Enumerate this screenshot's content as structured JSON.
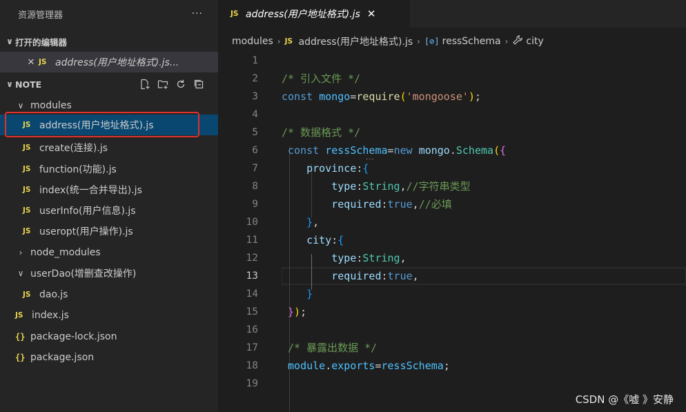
{
  "sidebar": {
    "title": "资源管理器",
    "more": "···",
    "open_editors_section": "打开的编辑器",
    "open_editor_file": "address(用户地址格式).js...",
    "root_section": "NOTE",
    "tree": [
      {
        "type": "folder",
        "label": "modules",
        "expanded": true
      },
      {
        "type": "js",
        "label": "address(用户地址格式).js",
        "selected": true
      },
      {
        "type": "js",
        "label": "create(连接).js"
      },
      {
        "type": "js",
        "label": "function(功能).js"
      },
      {
        "type": "js",
        "label": "index(统一合并导出).js"
      },
      {
        "type": "js",
        "label": "userInfo(用户信息).js"
      },
      {
        "type": "js",
        "label": "useropt(用户操作).js"
      },
      {
        "type": "folder",
        "label": "node_modules",
        "expanded": false
      },
      {
        "type": "folder",
        "label": "userDao(增删查改操作)",
        "expanded": true
      },
      {
        "type": "js",
        "label": "dao.js"
      },
      {
        "type": "js",
        "label": "index.js"
      },
      {
        "type": "json",
        "label": "package-lock.json"
      },
      {
        "type": "json",
        "label": "package.json"
      }
    ],
    "js_badge": "JS",
    "json_badge": "{}"
  },
  "tab": {
    "label": "address(用户地址格式).js",
    "close": "✕"
  },
  "breadcrumb": {
    "folder": "modules",
    "file": "address(用户地址格式).js",
    "symbol": "ressSchema",
    "property": "city",
    "var_glyph": "[⊘]"
  },
  "editor": {
    "current_line": 13,
    "line_numbers": [
      "1",
      "2",
      "3",
      "4",
      "5",
      "6",
      "7",
      "8",
      "9",
      "10",
      "11",
      "12",
      "13",
      "14",
      "15",
      "16",
      "17",
      "18",
      "19"
    ]
  },
  "watermark": "CSDN @《嘘 》安静",
  "colors": {
    "selection": "#094771",
    "highlight_box": "#e0312a",
    "js_icon": "#e8d44d"
  }
}
